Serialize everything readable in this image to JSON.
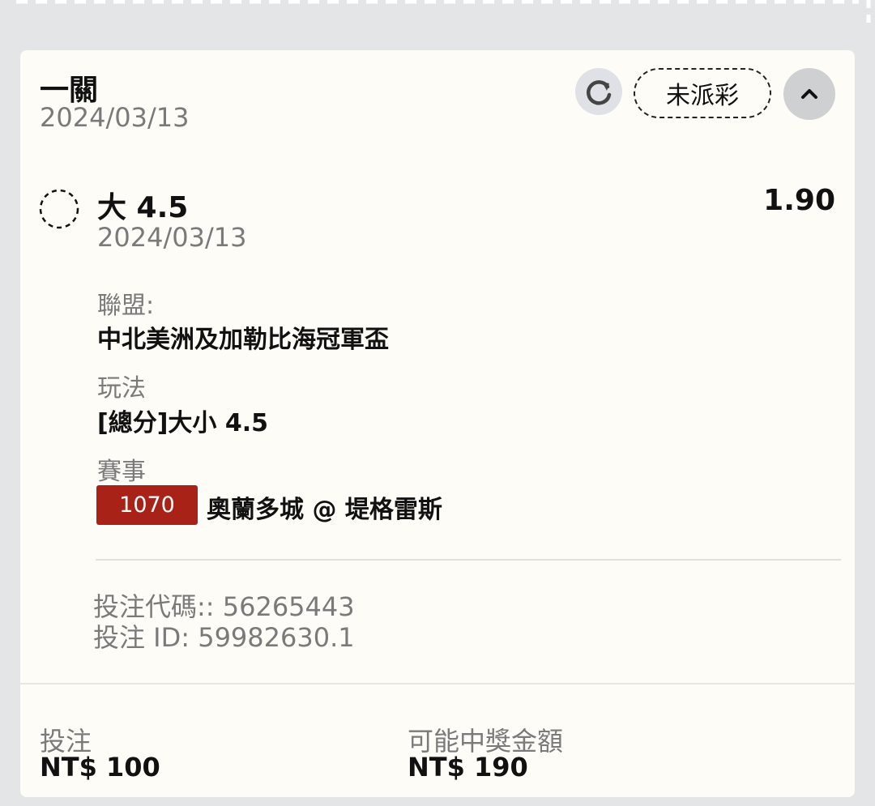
{
  "bet": {
    "type": "一關",
    "date": "2024/03/13",
    "status": "未派彩",
    "icons": {
      "refresh": "refresh-icon",
      "collapse": "chevron-up-icon",
      "selection_status": "pending-circle-icon"
    }
  },
  "selection": {
    "name": "大 4.5",
    "odds": "1.90",
    "date": "2024/03/13",
    "league_label": "聯盟:",
    "league_value": "中北美洲及加勒比海冠軍盃",
    "market_label": "玩法",
    "market_value": "[總分]大小 4.5",
    "event_label": "賽事",
    "match_code": "1070",
    "match_name": "奧蘭多城 @ 堤格雷斯"
  },
  "meta": {
    "bet_code": "投注代碼:: 56265443",
    "bet_id": "投注 ID: 59982630.1"
  },
  "summary": {
    "stake_label": "投注",
    "stake_value": "NT$ 100",
    "win_label": "可能中獎金額",
    "win_value": "NT$ 190"
  },
  "colors": {
    "background": "#e4e5e7",
    "card": "#fdfcf6",
    "match_badge": "#a82217",
    "muted_text": "#7a7a7a"
  }
}
